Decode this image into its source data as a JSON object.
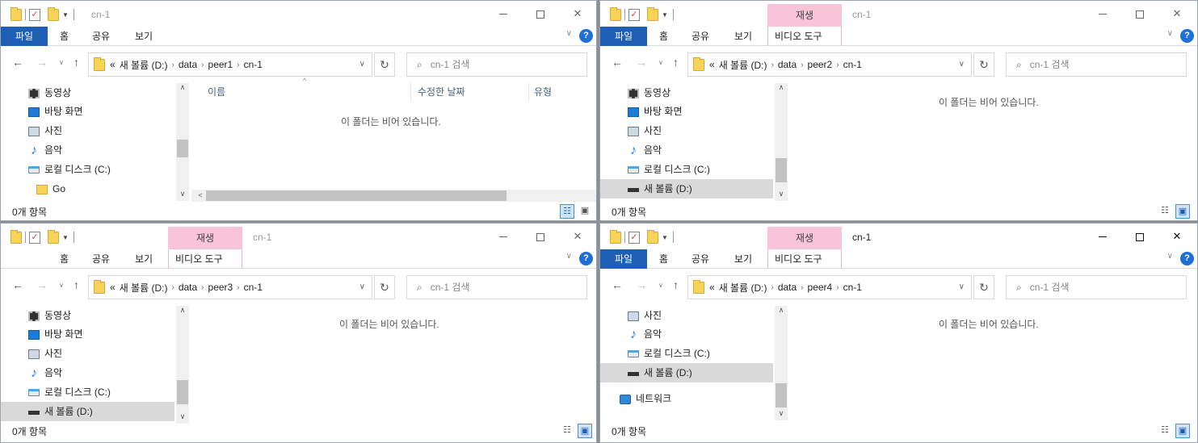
{
  "windows": [
    {
      "title": "cn-1",
      "title_active": false,
      "context_tab": null,
      "ribbon_tabs": [
        "파일",
        "홈",
        "공유",
        "보기"
      ],
      "path": [
        "새 볼륨 (D:)",
        "data",
        "peer1",
        "cn-1"
      ],
      "search_placeholder": "cn-1 검색",
      "nav_items": [
        {
          "label": "동영상",
          "icon": "video-icon"
        },
        {
          "label": "바탕 화면",
          "icon": "desktop-icon"
        },
        {
          "label": "사진",
          "icon": "pictures-icon"
        },
        {
          "label": "음악",
          "icon": "music-icon"
        },
        {
          "label": "로컬 디스크 (C:)",
          "icon": "local-disk-icon"
        },
        {
          "label": "Go",
          "icon": "folder-icon"
        }
      ],
      "columns": [
        "이름",
        "수정한 날짜",
        "유형"
      ],
      "empty_text": "이 폴더는 비어 있습니다.",
      "status": "0개 항목"
    },
    {
      "title": "cn-1",
      "title_active": false,
      "context_tab": "재생",
      "ribbon_tabs": [
        "파일",
        "홈",
        "공유",
        "보기",
        "비디오 도구"
      ],
      "path": [
        "새 볼륨 (D:)",
        "data",
        "peer2",
        "cn-1"
      ],
      "search_placeholder": "cn-1 검색",
      "nav_items": [
        {
          "label": "동영상",
          "icon": "video-icon"
        },
        {
          "label": "바탕 화면",
          "icon": "desktop-icon"
        },
        {
          "label": "사진",
          "icon": "pictures-icon"
        },
        {
          "label": "음악",
          "icon": "music-icon"
        },
        {
          "label": "로컬 디스크 (C:)",
          "icon": "local-disk-icon"
        },
        {
          "label": "새 볼륨 (D:)",
          "icon": "drive-icon",
          "selected": true
        }
      ],
      "empty_text": "이 폴더는 비어 있습니다.",
      "status": "0개 항목"
    },
    {
      "title": "cn-1",
      "title_active": false,
      "context_tab": "재생",
      "ribbon_tabs": [
        "홈",
        "공유",
        "보기",
        "비디오 도구"
      ],
      "path": [
        "새 볼륨 (D:)",
        "data",
        "peer3",
        "cn-1"
      ],
      "search_placeholder": "cn-1 검색",
      "nav_items": [
        {
          "label": "동영상",
          "icon": "video-icon"
        },
        {
          "label": "바탕 화면",
          "icon": "desktop-icon"
        },
        {
          "label": "사진",
          "icon": "pictures-icon"
        },
        {
          "label": "음악",
          "icon": "music-icon"
        },
        {
          "label": "로컬 디스크 (C:)",
          "icon": "local-disk-icon"
        },
        {
          "label": "새 볼륨 (D:)",
          "icon": "drive-icon",
          "selected": true
        }
      ],
      "empty_text": "이 폴더는 비어 있습니다.",
      "status": "0개 항목"
    },
    {
      "title": "cn-1",
      "title_active": true,
      "context_tab": "재생",
      "ribbon_tabs": [
        "파일",
        "홈",
        "공유",
        "보기",
        "비디오 도구"
      ],
      "path": [
        "새 볼륨 (D:)",
        "data",
        "peer4",
        "cn-1"
      ],
      "search_placeholder": "cn-1 검색",
      "nav_items": [
        {
          "label": "사진",
          "icon": "pictures-icon"
        },
        {
          "label": "음악",
          "icon": "music-icon"
        },
        {
          "label": "로컬 디스크 (C:)",
          "icon": "local-disk-icon"
        },
        {
          "label": "새 볼륨 (D:)",
          "icon": "drive-icon",
          "selected": true
        },
        {
          "label": "네트워크",
          "icon": "network-icon"
        }
      ],
      "empty_text": "이 폴더는 비어 있습니다.",
      "status": "0개 항목"
    }
  ],
  "common": {
    "back_glyph": "←",
    "forward_glyph": "→",
    "up_glyph": "↑",
    "breadcrumb_prefix": "«",
    "refresh_glyph": "↻",
    "search_glyph": "⌕",
    "help_glyph": "?",
    "close_glyph": "✕"
  }
}
